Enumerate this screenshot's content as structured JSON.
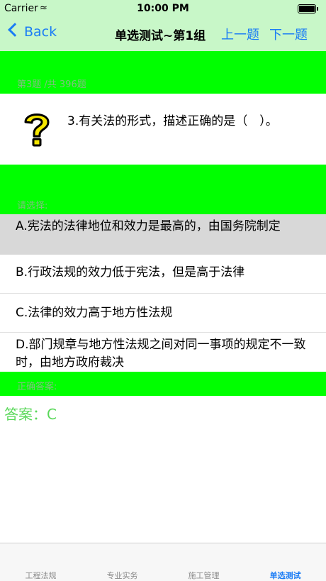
{
  "status": {
    "carrier": "Carrier",
    "time": "10:00 PM"
  },
  "nav": {
    "back": "Back",
    "title": "单选测试~第1组",
    "prev": "上一题",
    "next": "下一题"
  },
  "question": {
    "counter": "第3题 /共 396题",
    "text": "3.有关法的形式，描述正确的是（　）。",
    "icon": "question-mark-icon"
  },
  "choose_label": "请选择:",
  "options": [
    {
      "text": "A.宪法的法律地位和效力是最高的，由国务院制定",
      "selected": true
    },
    {
      "text": "B.行政法规的效力低于宪法，但是高于法律",
      "selected": false
    },
    {
      "text": "C.法律的效力高于地方性法规",
      "selected": false
    },
    {
      "text": "D.部门规章与地方性法规之间对同一事项的规定不一致时，由地方政府裁决",
      "selected": false
    }
  ],
  "correct_label": "正确答案:",
  "answer": "答案：C",
  "tabs": [
    {
      "label": "工程法规",
      "active": false
    },
    {
      "label": "专业实务",
      "active": false
    },
    {
      "label": "施工管理",
      "active": false
    },
    {
      "label": "单选测试",
      "active": true
    }
  ],
  "colors": {
    "header": "#c8f7c8",
    "band": "#00ff00",
    "accent": "#1a7cf5",
    "selected": "#d8d8d8",
    "answer": "#5ad85a"
  }
}
